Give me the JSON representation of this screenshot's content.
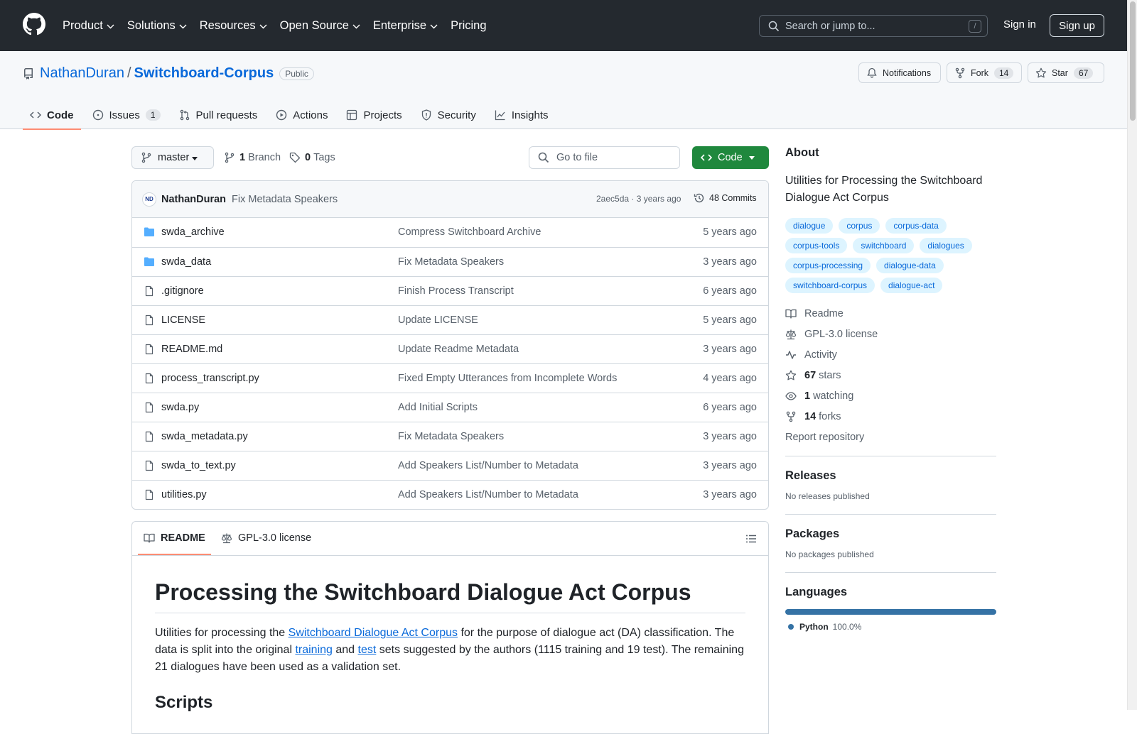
{
  "header": {
    "nav": [
      {
        "label": "Product",
        "dropdown": true
      },
      {
        "label": "Solutions",
        "dropdown": true
      },
      {
        "label": "Resources",
        "dropdown": true
      },
      {
        "label": "Open Source",
        "dropdown": true
      },
      {
        "label": "Enterprise",
        "dropdown": true
      },
      {
        "label": "Pricing",
        "dropdown": false
      }
    ],
    "search_placeholder": "Search or jump to...",
    "search_shortcut": "/",
    "sign_in": "Sign in",
    "sign_up": "Sign up"
  },
  "repo": {
    "owner": "NathanDuran",
    "separator": "/",
    "name": "Switchboard-Corpus",
    "visibility": "Public",
    "notifications_label": "Notifications",
    "fork_label": "Fork",
    "fork_count": "14",
    "star_label": "Star",
    "star_count": "67"
  },
  "tabs": [
    {
      "label": "Code",
      "icon": "code-icon",
      "active": true
    },
    {
      "label": "Issues",
      "icon": "issue-icon",
      "count": "1"
    },
    {
      "label": "Pull requests",
      "icon": "pull-request-icon"
    },
    {
      "label": "Actions",
      "icon": "play-icon"
    },
    {
      "label": "Projects",
      "icon": "table-icon"
    },
    {
      "label": "Security",
      "icon": "shield-icon"
    },
    {
      "label": "Insights",
      "icon": "graph-icon"
    }
  ],
  "branchbar": {
    "branch": "master",
    "branch_count": "1",
    "branch_label": "Branch",
    "tag_count": "0",
    "tag_label": "Tags",
    "goto_placeholder": "Go to file",
    "code_button": "Code"
  },
  "commit": {
    "avatar_text": "ND",
    "author": "NathanDuran",
    "message": "Fix Metadata Speakers",
    "meta": "2aec5da · 3 years ago",
    "commits_label": "48 Commits"
  },
  "files": [
    {
      "type": "dir",
      "name": "swda_archive",
      "message": "Compress Switchboard Archive",
      "time": "5 years ago"
    },
    {
      "type": "dir",
      "name": "swda_data",
      "message": "Fix Metadata Speakers",
      "time": "3 years ago"
    },
    {
      "type": "file",
      "name": ".gitignore",
      "message": "Finish Process Transcript",
      "time": "6 years ago"
    },
    {
      "type": "file",
      "name": "LICENSE",
      "message": "Update LICENSE",
      "time": "5 years ago"
    },
    {
      "type": "file",
      "name": "README.md",
      "message": "Update Readme Metadata",
      "time": "3 years ago"
    },
    {
      "type": "file",
      "name": "process_transcript.py",
      "message": "Fixed Empty Utterances from Incomplete Words",
      "time": "4 years ago"
    },
    {
      "type": "file",
      "name": "swda.py",
      "message": "Add Initial Scripts",
      "time": "6 years ago"
    },
    {
      "type": "file",
      "name": "swda_metadata.py",
      "message": "Fix Metadata Speakers",
      "time": "3 years ago"
    },
    {
      "type": "file",
      "name": "swda_to_text.py",
      "message": "Add Speakers List/Number to Metadata",
      "time": "3 years ago"
    },
    {
      "type": "file",
      "name": "utilities.py",
      "message": "Add Speakers List/Number to Metadata",
      "time": "3 years ago"
    }
  ],
  "readme": {
    "tab_readme": "README",
    "tab_license": "GPL-3.0 license",
    "title": "Processing the Switchboard Dialogue Act Corpus",
    "p1_a": "Utilities for processing the ",
    "p1_link1": "Switchboard Dialogue Act Corpus",
    "p1_b": " for the purpose of dialogue act (DA) classification. The data is split into the original ",
    "p1_link2": "training",
    "p1_c": " and ",
    "p1_link3": "test",
    "p1_d": " sets suggested by the authors (1115 training and 19 test). The remaining 21 dialogues have been used as a validation set.",
    "h2": "Scripts"
  },
  "about": {
    "title": "About",
    "description": "Utilities for Processing the Switchboard Dialogue Act Corpus",
    "topics": [
      "dialogue",
      "corpus",
      "corpus-data",
      "corpus-tools",
      "switchboard",
      "dialogues",
      "corpus-processing",
      "dialogue-data",
      "switchboard-corpus",
      "dialogue-act"
    ],
    "readme": "Readme",
    "license": "GPL-3.0 license",
    "activity": "Activity",
    "stars_count": "67",
    "stars_label": "stars",
    "watching_count": "1",
    "watching_label": "watching",
    "forks_count": "14",
    "forks_label": "forks",
    "report": "Report repository"
  },
  "releases": {
    "title": "Releases",
    "text": "No releases published"
  },
  "packages": {
    "title": "Packages",
    "text": "No packages published"
  },
  "languages": {
    "title": "Languages",
    "items": [
      {
        "name": "Python",
        "percent": "100.0%",
        "color": "#3572A5",
        "share": 1.0
      }
    ]
  },
  "colors": {
    "header_bg": "#24292f",
    "link": "#0969da",
    "code_button": "#1f883d",
    "tab_underline": "#fd8c73"
  }
}
